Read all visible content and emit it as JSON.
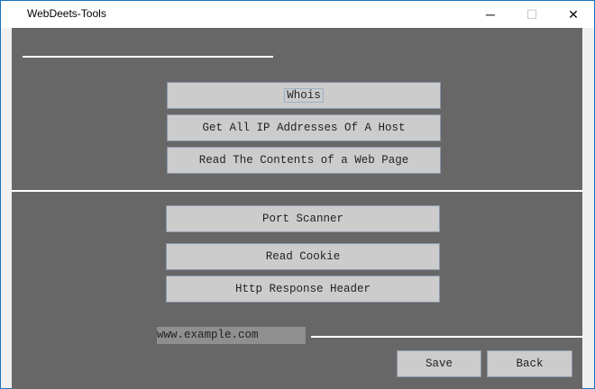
{
  "window": {
    "title": "WebDeets-Tools",
    "minimize": "─",
    "maximize": "☐",
    "close": "✕"
  },
  "buttons": {
    "whois": "Whois",
    "all_ips": "Get All IP Addresses Of A Host",
    "read_page": "Read The Contents of a Web Page",
    "port_scanner": "Port Scanner",
    "read_cookie": "Read Cookie",
    "http_header": "Http Response Header",
    "save": "Save",
    "back": "Back"
  },
  "url_input": {
    "value": "www.example.com"
  }
}
